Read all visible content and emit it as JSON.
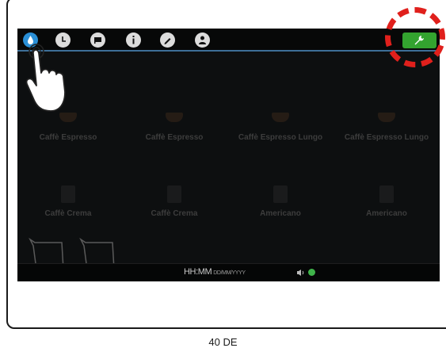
{
  "toolbar": {
    "icons": [
      "water-drop-icon",
      "clock-icon",
      "flag-icon",
      "info-icon",
      "pencil-icon",
      "user-icon"
    ],
    "active_icon": "water-drop-icon",
    "settings_icon": "wrench-icon",
    "accent_color": "#33a32f",
    "selected_color": "#2a8fd6"
  },
  "drinks": [
    {
      "label": "Caffè Espresso"
    },
    {
      "label": "Caffè Espresso"
    },
    {
      "label": "Caffè Espresso Lungo"
    },
    {
      "label": "Caffè Espresso Lungo"
    },
    {
      "label": "Caffè Crema"
    },
    {
      "label": "Caffè Crema"
    },
    {
      "label": "Americano"
    },
    {
      "label": "Americano"
    }
  ],
  "statusbar": {
    "time": "HH:MM",
    "date": "DD/MM/YYYY",
    "volume_icon": "speaker-icon",
    "eco_icon": "eco-icon"
  },
  "annotation": {
    "highlight_color": "#e0201c",
    "hand_icon": "pointing-hand-icon"
  },
  "footer": {
    "page": "40 DE"
  }
}
